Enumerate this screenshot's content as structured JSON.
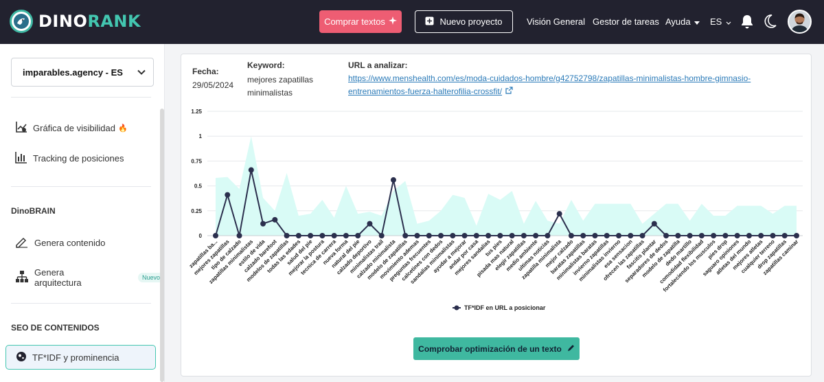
{
  "header": {
    "logo_part1": "DINO",
    "logo_part2": "RANK",
    "buy_texts": "Comprar textos",
    "new_project": "Nuevo proyecto",
    "overview": "Visión General",
    "tasks": "Gestor de tareas",
    "help": "Ayuda",
    "lang": "ES",
    "icons": [
      "sparkle-icon",
      "plus-square-icon",
      "chevron-down-icon",
      "bell-icon",
      "moon-icon"
    ]
  },
  "sidebar": {
    "project": "imparables.agency - ES",
    "nav": [
      {
        "label": "Gráfica de visibilidad",
        "icon": "chart-line-icon",
        "emoji": "🔥"
      },
      {
        "label": "Tracking de posiciones",
        "icon": "bar-chart-icon"
      }
    ],
    "dinobrain_title": "DinoBRAIN",
    "dinobrain": [
      {
        "label": "Genera contenido",
        "icon": "pen-icon"
      },
      {
        "label": "Genera arquitectura",
        "icon": "sitemap-icon",
        "badge": "Nuevo"
      }
    ],
    "seo_title": "SEO DE CONTENIDOS",
    "active_item": "TF*IDF y prominencia"
  },
  "main": {
    "date_label": "Fecha:",
    "date_value": "29/05/2024",
    "keyword_label": "Keyword:",
    "keyword_value": "mejores zapatillas minimalistas",
    "url_label": "URL a analizar:",
    "url_line1": "https://www.menshealth.com/es/moda-cuidados-hombre/g42752798/zapatillas-minimalistas-hombre-gimnasio-",
    "url_line2": "entrenamientos-fuerza-halterofilia-crossfit/",
    "check_button": "Comprobar optimización de un texto"
  },
  "colors": {
    "topbar": "#22222f",
    "accent": "#43c6b0",
    "buy": "#ee5d73",
    "series_line": "#2b2f4d",
    "area_fill": "#d9fbf6"
  },
  "chart_data": {
    "type": "line",
    "ylim": [
      0,
      1.25
    ],
    "yticks": [
      "1.25",
      "1",
      "0.75",
      "0.5",
      "0.25",
      "0"
    ],
    "legend": "TF*IDF en URL a posicionar",
    "legend_position": "bottom",
    "categories": [
      "zapatillas ba...",
      "mejores zapatillas",
      "tipo de calzado",
      "zapatillas minimalistas",
      "estilo de vida",
      "calzado barefoot",
      "modelos de zapatillas",
      "todas las edades",
      "salud del pie",
      "mejorar la postura",
      "tecnica de carrera",
      "nueva forma",
      "natural del pie",
      "calzado deportivo",
      "minimalistas trail",
      "calzado minimalista",
      "modelo de zapatillas",
      "movimiento ademas",
      "preguntas frecuentes",
      "calcetines con dedos",
      "sandalias minimalistas",
      "ayudar a mejorar",
      "andar por casa",
      "mejores sandalias",
      "tus pies",
      "pisada mas natural",
      "elegir zapatillas",
      "medio ambiente",
      "ultimas noticias",
      "zapatilla minimalista",
      "mejor calzado",
      "baratas zapatillas",
      "minimalistas baratas",
      "invierno zapatillas",
      "minimalistas invierno",
      "esa sensacion",
      "ofrecen las zapatillas",
      "fascitis plantar",
      "separadores de dedos",
      "modelo de zapatilla",
      "dedo martillo",
      "comodidad flexibilidad",
      "fortaleciendo los musculos",
      "pies drop",
      "saguaro opiniones",
      "atletas del mundo",
      "mejores atletas",
      "cualquier terreno",
      "drop zapatillas",
      "zapatillas caminar"
    ],
    "series": [
      {
        "name": "TF*IDF en URL a posicionar",
        "values": [
          0,
          0.41,
          0,
          0.66,
          0.12,
          0.16,
          0,
          0,
          0,
          0,
          0,
          0,
          0,
          0.12,
          0,
          0.56,
          0,
          0,
          0,
          0,
          0,
          0,
          0,
          0,
          0,
          0,
          0,
          0,
          0,
          0.22,
          0,
          0,
          0,
          0,
          0,
          0,
          0,
          0.12,
          0,
          0,
          0,
          0,
          0,
          0,
          0,
          0,
          0,
          0,
          0,
          0
        ]
      }
    ],
    "range_max": [
      0.58,
      0.59,
      0.47,
      1.0,
      0.38,
      0.25,
      0.63,
      0.2,
      0.22,
      0.36,
      0.18,
      0.5,
      0.22,
      0.24,
      0.2,
      0.45,
      0.55,
      0.12,
      0.15,
      0.25,
      0.41,
      0.38,
      0.1,
      0.42,
      0.36,
      0.45,
      0.12,
      0.35,
      0.15,
      0.12,
      0.36,
      0.15,
      0.32,
      0.32,
      0.32,
      0.32,
      0.12,
      0.22,
      0.32,
      0.32,
      0.15,
      0.32,
      0.2,
      0.2,
      0.3,
      0.3,
      0.3,
      0.22,
      0.3,
      0.3
    ]
  }
}
